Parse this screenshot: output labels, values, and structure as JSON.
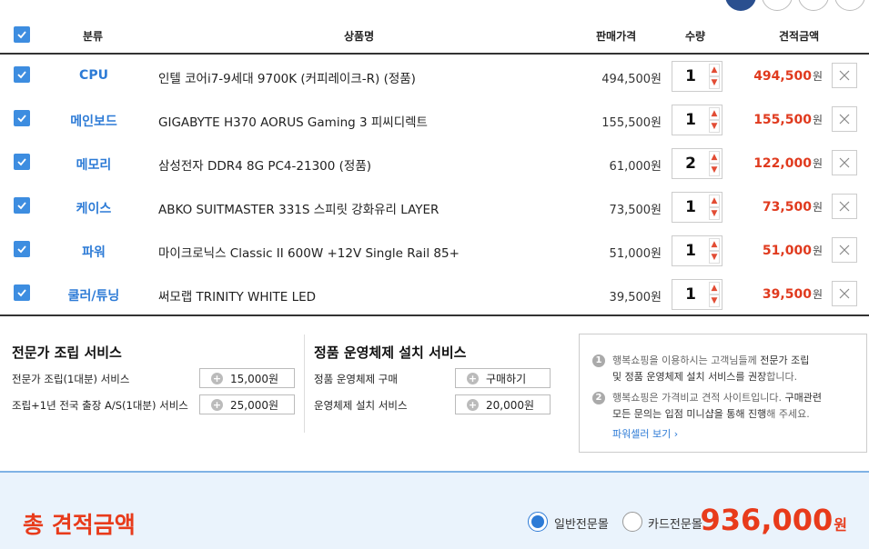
{
  "header": {
    "category": "분류",
    "product": "상품명",
    "price": "판매가격",
    "qty": "수량",
    "total": "견적금액"
  },
  "items": [
    {
      "category": "CPU",
      "name": "인텔 코어i7-9세대 9700K (커피레이크-R) (정품)",
      "price": "494,500원",
      "qty": "1",
      "total": "494,500",
      "won": "원"
    },
    {
      "category": "메인보드",
      "name": "GIGABYTE H370 AORUS Gaming 3 피씨디렉트",
      "price": "155,500원",
      "qty": "1",
      "total": "155,500",
      "won": "원"
    },
    {
      "category": "메모리",
      "name": "삼성전자 DDR4 8G PC4-21300 (정품)",
      "price": "61,000원",
      "qty": "2",
      "total": "122,000",
      "won": "원"
    },
    {
      "category": "케이스",
      "name": "ABKO SUITMASTER 331S 스피릿 강화유리 LAYER",
      "price": "73,500원",
      "qty": "1",
      "total": "73,500",
      "won": "원"
    },
    {
      "category": "파워",
      "name": "마이크로닉스 Classic II 600W +12V Single Rail 85+",
      "price": "51,000원",
      "qty": "1",
      "total": "51,000",
      "won": "원"
    },
    {
      "category": "쿨러/튜닝",
      "name": "써모랩 TRINITY WHITE LED",
      "price": "39,500원",
      "qty": "1",
      "total": "39,500",
      "won": "원"
    }
  ],
  "assembly": {
    "title": "전문가 조립 서비스",
    "options": [
      {
        "label": "전문가 조립(1대분) 서비스",
        "button": "15,000원"
      },
      {
        "label": "조립+1년 전국 출장 A/S(1대분) 서비스",
        "button": "25,000원"
      }
    ]
  },
  "os": {
    "title": "정품 운영체제 설치 서비스",
    "options": [
      {
        "label": "정품 운영체제 구매",
        "button": "구매하기"
      },
      {
        "label": "운영체제 설치 서비스",
        "button": "20,000원"
      }
    ]
  },
  "notice": {
    "n1": "1",
    "l1a_pre": "행복쇼핑을 이용하시는 고객님들께 ",
    "l1a_b": "전문가 조립",
    "l1b_b": "및 정품 운영체제 설치 서비스를 권장",
    "l1b_post": "합니다.",
    "n2": "2",
    "l2a_pre": "행복쇼핑은 가격비교 견적 사이트입니다. ",
    "l2a_b": "구매관련",
    "l2b_b": "모든 문의는 입점 미니샵을 통해 진행",
    "l2b_post": "해 주세요.",
    "link": "파워셀러 보기 ›"
  },
  "summary": {
    "label": "총 견적금액",
    "radio1": "일반전문몰",
    "radio2": "카드전문몰",
    "amount": "936,000",
    "won": "원"
  },
  "colors": {
    "accent": "#2d7bd6",
    "price_red": "#e03a1e",
    "checkbox": "#3d8de0"
  }
}
